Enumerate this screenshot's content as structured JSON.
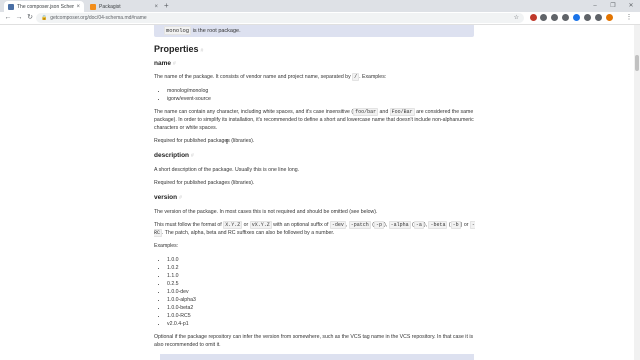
{
  "browser": {
    "tabs": [
      {
        "title": "The composer.json Schem",
        "active": true,
        "favicon_color": "#4a6fa5"
      },
      {
        "title": "Packagist",
        "active": false,
        "favicon_color": "#f28d1a"
      }
    ],
    "new_tab": "+",
    "url": "getcomposer.org/doc/04-schema.md#name",
    "window_controls": [
      "–",
      "❐",
      "✕"
    ],
    "extension_colors": [
      "#c0392b",
      "#5f6368",
      "#5f6368",
      "#5f6368",
      "#1a73e8",
      "#5f6368",
      "#5f6368",
      "#e37400"
    ]
  },
  "page": {
    "notice_text": "monolog",
    "notice_suffix": " is the root package.",
    "heading": "Properties",
    "anchor": "#",
    "name": {
      "title": "name",
      "p1_a": "The name of the package. It consists of vendor name and project name, separated by ",
      "p1_code": "/",
      "p1_b": ". Examples:",
      "examples": [
        "monolog/monolog",
        "igorw/event-source"
      ],
      "p2_a": "The name can contain any character, including white spaces, and it's case insensitive (",
      "p2_code1": "foo/bar",
      "p2_mid": " and ",
      "p2_code2": "Foo/Bar",
      "p2_b": " are considered the same package). In order to simplify its installation, it's recommended to define a short and lowercase name that doesn't include non-alphanumeric characters or white spaces.",
      "required": "Required for published packages (libraries)."
    },
    "description": {
      "title": "description",
      "p1": "A short description of the package. Usually this is one line long.",
      "required": "Required for published packages (libraries)."
    },
    "version": {
      "title": "version",
      "p1": "The version of the package. In most cases this is not required and should be omitted (see below).",
      "p2_a": "This must follow the format of ",
      "c1": "X.Y.Z",
      "or1": " or ",
      "c2": "vX.Y.Z",
      "p2_b": " with an optional suffix of ",
      "c3": "-dev",
      "comma1": ", ",
      "c4": "-patch",
      "paren1": " (",
      "c5": "-p",
      "paren2": "), ",
      "c6": "-alpha",
      "paren3": " (",
      "c7": "-a",
      "paren4": "), ",
      "c8": "-beta",
      "paren5": " (",
      "c9": "-b",
      "paren6": ")",
      "or2": " or ",
      "c10": "-RC",
      "p2_c": ". The patch, alpha, beta and RC suffixes can also be followed by a number.",
      "examples_label": "Examples:",
      "examples": [
        "1.0.0",
        "1.0.2",
        "1.1.0",
        "0.2.5",
        "1.0.0-dev",
        "1.0.0-alpha3",
        "1.0.0-beta2",
        "1.0.0-RC5",
        "v2.0.4-p1"
      ],
      "p3": "Optional if the package repository can infer the version from somewhere, such as the VCS tag name in the VCS repository. In that case it is also recommended to omit it."
    }
  }
}
